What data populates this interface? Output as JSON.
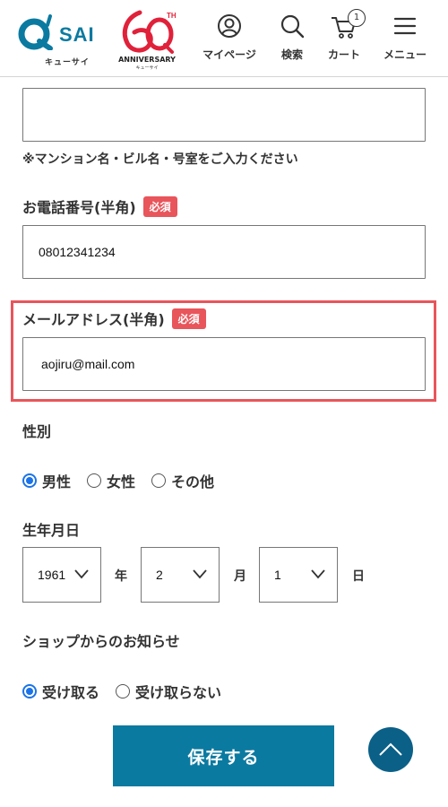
{
  "brand": {
    "logo_name": "SAI",
    "logo_sub": "キューサイ",
    "anniversary_label": "ANNIVERSARY",
    "anniversary_sub": "キューサイ",
    "anniversary_th": "TH",
    "accent": "#0b7aa0",
    "red": "#e8555b"
  },
  "nav": {
    "mypage": "マイページ",
    "search": "検索",
    "cart": "カート",
    "cart_count": "1",
    "menu": "メニュー"
  },
  "form": {
    "address_note": "※マンション名・ビル名・号室をご入力ください",
    "address_value": "",
    "phone_label": "お電話番号(半角)",
    "phone_required": "必須",
    "phone_value": "08012341234",
    "email_label": "メールアドレス(半角)",
    "email_required": "必須",
    "email_value": "aojiru@mail.com",
    "gender_label": "性別",
    "gender_options": [
      "男性",
      "女性",
      "その他"
    ],
    "gender_selected": "男性",
    "birthday_label": "生年月日",
    "birth_year": "1961",
    "birth_year_unit": "年",
    "birth_month": "2",
    "birth_month_unit": "月",
    "birth_day": "1",
    "birth_day_unit": "日",
    "newsletter_label": "ショップからのお知らせ",
    "newsletter_options": [
      "受け取る",
      "受け取らない"
    ],
    "newsletter_selected": "受け取る",
    "save_label": "保存する"
  },
  "icons": {
    "mypage": "user-circle-icon",
    "search": "search-icon",
    "cart": "cart-icon",
    "menu": "hamburger-icon",
    "back_to_top": "chevron-up-icon",
    "select": "chevron-down-icon"
  }
}
